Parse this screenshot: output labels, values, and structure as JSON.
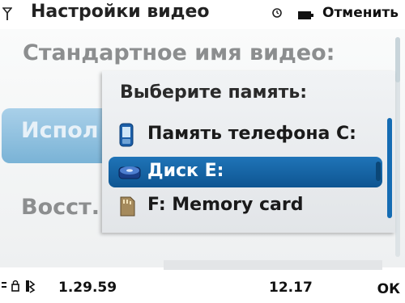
{
  "header": {
    "title": "Настройки видео",
    "cancel_label": "Отменить"
  },
  "settings": {
    "items": [
      {
        "label": "Стандартное имя видео:"
      },
      {
        "label": "Испол"
      },
      {
        "label": "Восст."
      }
    ]
  },
  "popup": {
    "title": "Выберите память:",
    "options": [
      {
        "label": "Память телефона C:",
        "icon": "phone-icon",
        "selected": false
      },
      {
        "label": "Диск E:",
        "icon": "disk-icon",
        "selected": true
      },
      {
        "label": "F: Memory card",
        "icon": "memory-card-icon",
        "selected": false
      }
    ]
  },
  "footer": {
    "left_time": "1.29.59",
    "center_time": "12.17",
    "ok_label": "ОК"
  },
  "colors": {
    "selection": "#0e5592",
    "highlight": "#7ab3d6",
    "scrollbar": "#156cb3"
  }
}
